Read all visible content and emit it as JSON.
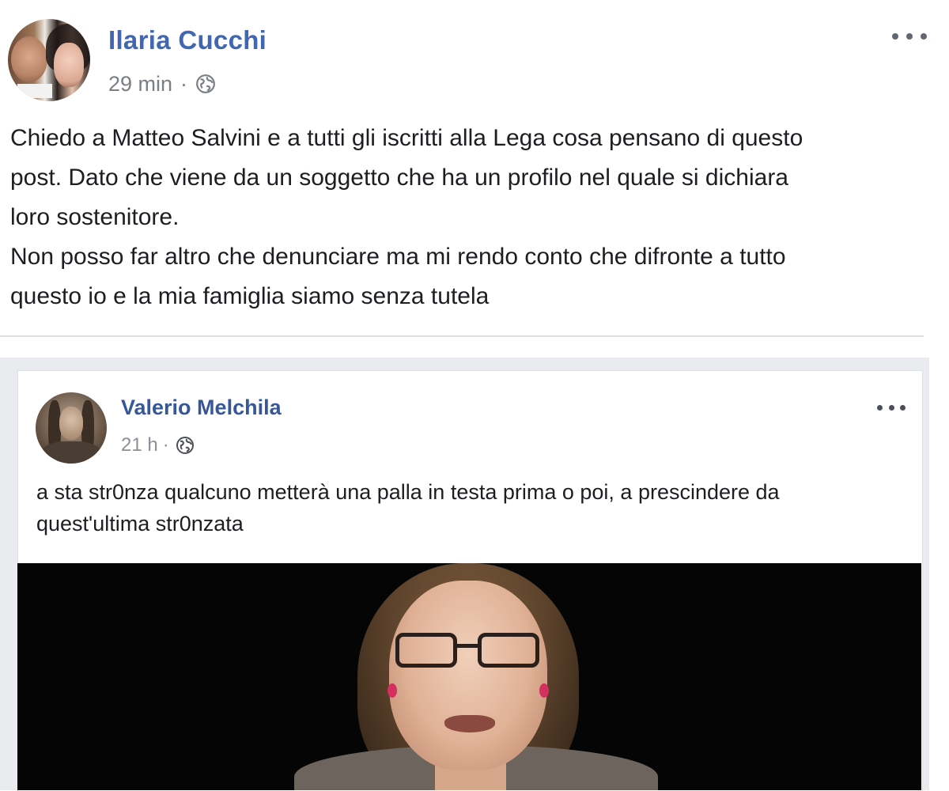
{
  "post": {
    "author": "Ilaria Cucchi",
    "time": "29 min",
    "separator": "·",
    "text_lines": [
      "Chiedo a Matteo Salvini e a tutti gli iscritti alla Lega cosa pensano di questo",
      "post. Dato che viene da un soggetto che ha un profilo nel quale si dichiara",
      "loro sostenitore.",
      "Non posso far altro che denunciare ma mi rendo conto che difronte a tutto",
      "questo io e la mia famiglia siamo senza tutela"
    ]
  },
  "shared": {
    "author": "Valerio Melchila",
    "time": "21 h",
    "separator": "·",
    "text_lines": [
      "a sta str0nza qualcuno metterà una palla in testa prima o poi, a prescindere da",
      "quest'ultima str0nzata"
    ]
  },
  "colors": {
    "author_link": "#4267b2",
    "shared_author_link": "#365899",
    "meta_gray": "#7a7e85",
    "divider": "#dddfe2"
  },
  "icons": {
    "privacy": "globe-icon",
    "menu": "more-options-icon"
  }
}
